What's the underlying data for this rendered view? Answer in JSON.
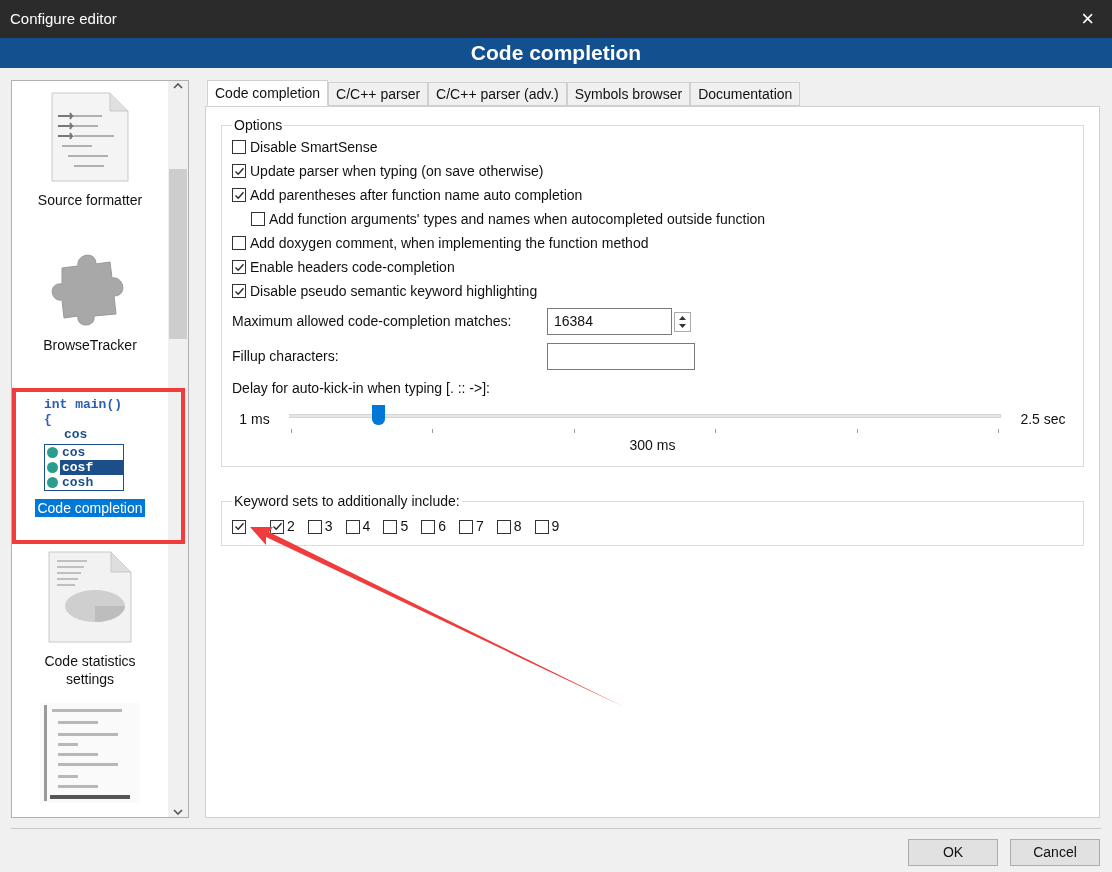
{
  "window": {
    "title": "Configure editor",
    "close": "×"
  },
  "header": {
    "title": "Code completion"
  },
  "sidebar": {
    "items": [
      {
        "kind": "document",
        "label": "Source formatter",
        "selected": false
      },
      {
        "kind": "puzzle",
        "label": "BrowseTracker",
        "selected": false
      },
      {
        "kind": "code",
        "label": "Code completion",
        "selected": true,
        "preview": {
          "code": [
            "int main()",
            "{",
            "cos"
          ],
          "suggestions": [
            {
              "text": "cos",
              "selected": false
            },
            {
              "text": "cosf",
              "selected": true
            },
            {
              "text": "cosh",
              "selected": false
            }
          ]
        }
      },
      {
        "kind": "chart",
        "label": "Code statistics settings",
        "selected": false
      },
      {
        "kind": "doxy"
      }
    ]
  },
  "tabs": [
    {
      "label": "Code completion",
      "selected": true
    },
    {
      "label": "C/C++ parser",
      "selected": false
    },
    {
      "label": "C/C++ parser (adv.)",
      "selected": false
    },
    {
      "label": "Symbols browser",
      "selected": false
    },
    {
      "label": "Documentation",
      "selected": false
    }
  ],
  "options": {
    "title": "Options",
    "checkboxes": [
      {
        "label": "Disable SmartSense",
        "checked": false
      },
      {
        "label": "Update parser when typing (on save otherwise)",
        "checked": true
      },
      {
        "label": "Add parentheses after function name auto completion",
        "checked": true,
        "children": [
          {
            "label": "Add function arguments' types and names when autocompleted outside function",
            "checked": false
          }
        ]
      },
      {
        "label": "Add doxygen comment, when implementing the function method",
        "checked": false
      },
      {
        "label": "Enable headers code-completion",
        "checked": true
      },
      {
        "label": "Disable pseudo semantic keyword highlighting",
        "checked": true
      }
    ],
    "max_matches": {
      "label": "Maximum allowed code-completion matches:",
      "value": "16384"
    },
    "fillup": {
      "label": "Fillup characters:"
    },
    "delay": {
      "label": "Delay for auto-kick-in when typing [. :: ->]:",
      "min": "1 ms",
      "max": "2.5 sec",
      "reading": "300 ms",
      "level": 0.125
    }
  },
  "keyword_sets": {
    "title": "Keyword sets to additionally include:",
    "items": [
      {
        "checked": true
      },
      {
        "label": "2",
        "checked": true
      },
      {
        "label": "3",
        "checked": false
      },
      {
        "label": "4",
        "checked": false
      },
      {
        "label": "5",
        "checked": false
      },
      {
        "label": "6",
        "checked": false
      },
      {
        "label": "7",
        "checked": false
      },
      {
        "label": "8",
        "checked": false
      },
      {
        "label": "9",
        "checked": false
      }
    ]
  },
  "buttons": [
    "OK",
    "Cancel"
  ]
}
